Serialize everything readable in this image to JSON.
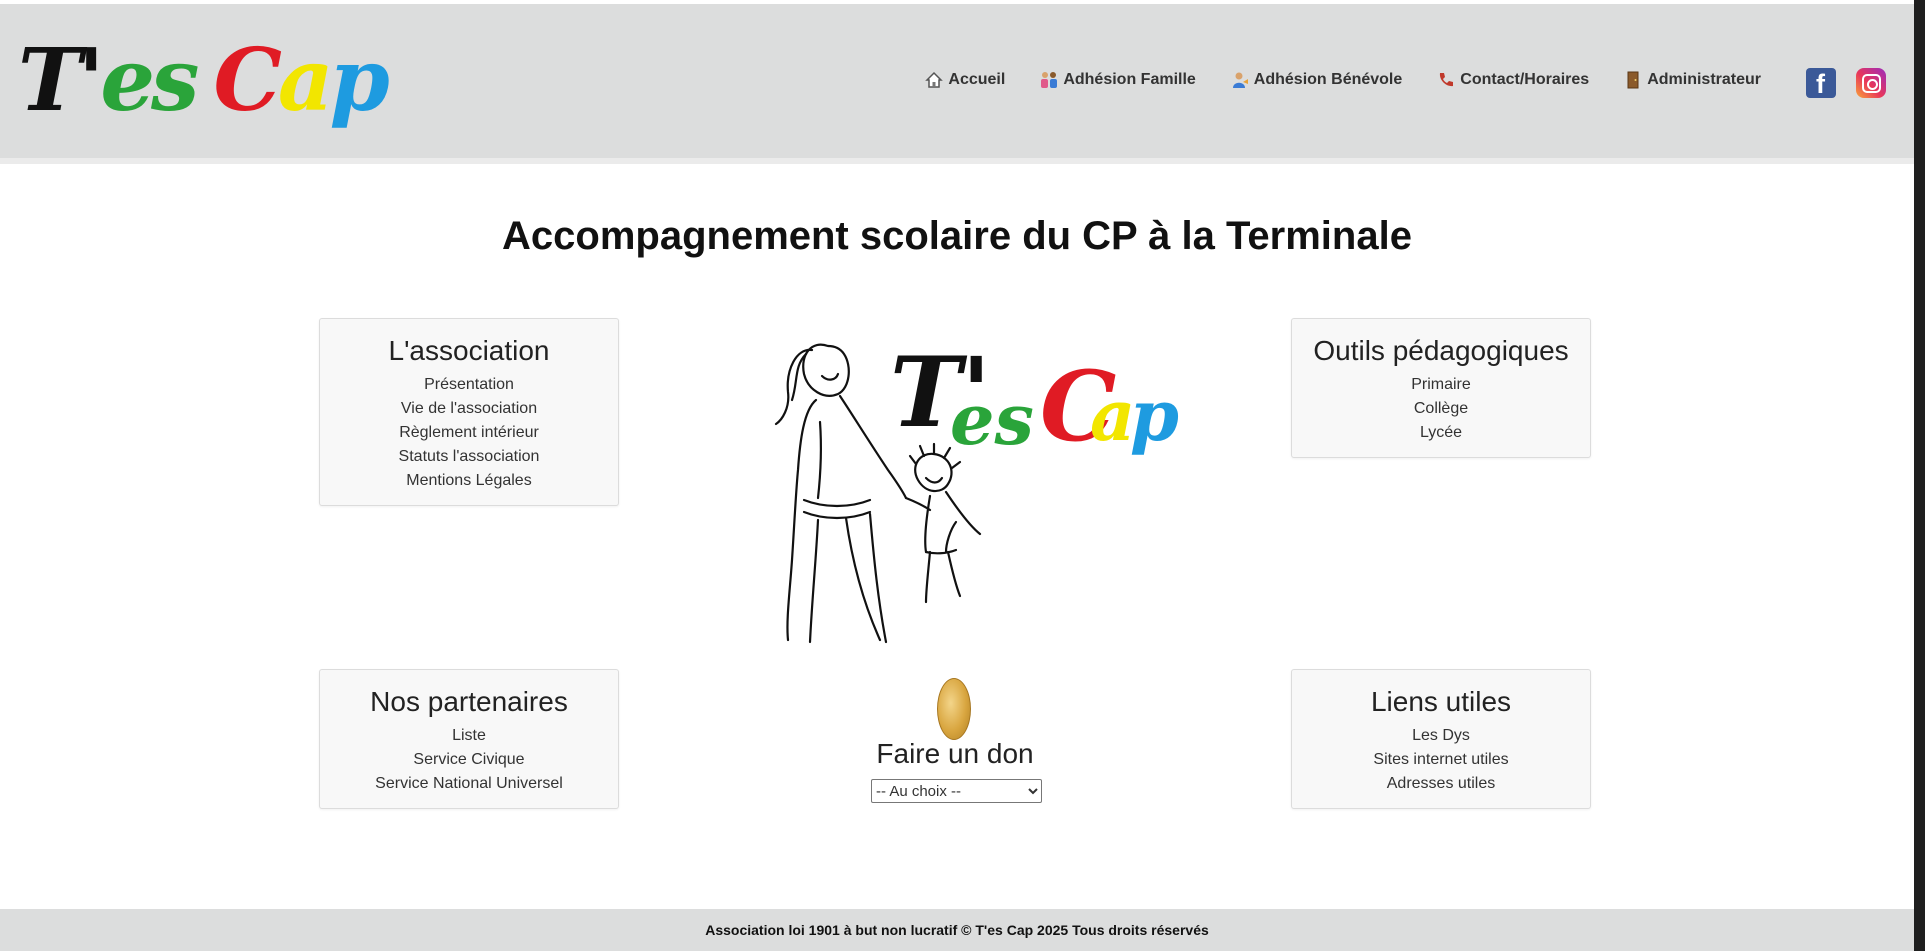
{
  "header": {
    "logo": {
      "parts": [
        "T'",
        "es",
        "C",
        "a",
        "p"
      ],
      "colors": [
        "#111111",
        "#2aa43a",
        "#e01b24",
        "#f2e600",
        "#1e9be0"
      ]
    },
    "nav": [
      {
        "label": "Accueil",
        "icon": "home-icon"
      },
      {
        "label": "Adhésion Famille",
        "icon": "family-icon"
      },
      {
        "label": "Adhésion Bénévole",
        "icon": "volunteer-icon"
      },
      {
        "label": "Contact/Horaires",
        "icon": "phone-icon"
      },
      {
        "label": "Administrateur",
        "icon": "door-icon"
      }
    ],
    "social": [
      "facebook-icon",
      "instagram-icon"
    ]
  },
  "main": {
    "title": "Accompagnement scolaire du CP à la Terminale",
    "cards": {
      "association": {
        "title": "L'association",
        "links": [
          "Présentation",
          "Vie de l'association",
          "Règlement intérieur",
          "Statuts l'association",
          "Mentions Légales"
        ]
      },
      "outils": {
        "title": "Outils pédagogiques",
        "links": [
          "Primaire",
          "Collège",
          "Lycée"
        ]
      },
      "partenaires": {
        "title": "Nos partenaires",
        "links": [
          "Liste",
          "Service Civique",
          "Service National Universel"
        ]
      },
      "liens": {
        "title": "Liens utiles",
        "links": [
          "Les Dys",
          "Sites internet utiles",
          "Adresses utiles"
        ]
      }
    },
    "donation": {
      "title": "Faire un don",
      "selected": "-- Au choix --"
    }
  },
  "footer": {
    "text": "Association loi 1901 à but non lucratif © T'es Cap 2025 Tous droits réservés"
  },
  "colors": {
    "header_bg": "#dcdddd",
    "card_bg": "#f8f8f8",
    "footer_bg": "#dcdddd"
  }
}
